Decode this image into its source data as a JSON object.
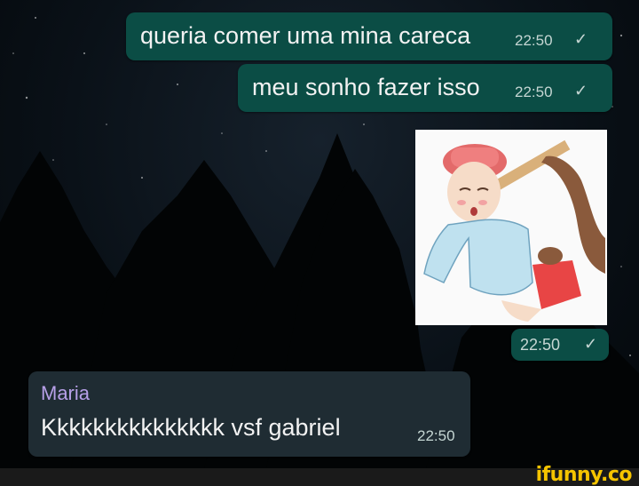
{
  "messages": [
    {
      "text": "queria comer uma mina careca",
      "time": "22:50",
      "status": "✓"
    },
    {
      "text": "meu sonho fazer isso",
      "time": "22:50",
      "status": "✓"
    },
    {
      "image": "anime-drawing-image",
      "time": "22:50",
      "status": "✓"
    }
  ],
  "incoming": {
    "sender": "Maria",
    "text": "Kkkkkkkkkkkkkkk vsf gabriel",
    "time": "22:50"
  },
  "watermark": "ifunny.co",
  "colors": {
    "outgoing_bubble": "#0b4d45",
    "incoming_bubble": "#1f2c33",
    "sender_name": "#b7a0e8",
    "brand": "#f5c400"
  }
}
